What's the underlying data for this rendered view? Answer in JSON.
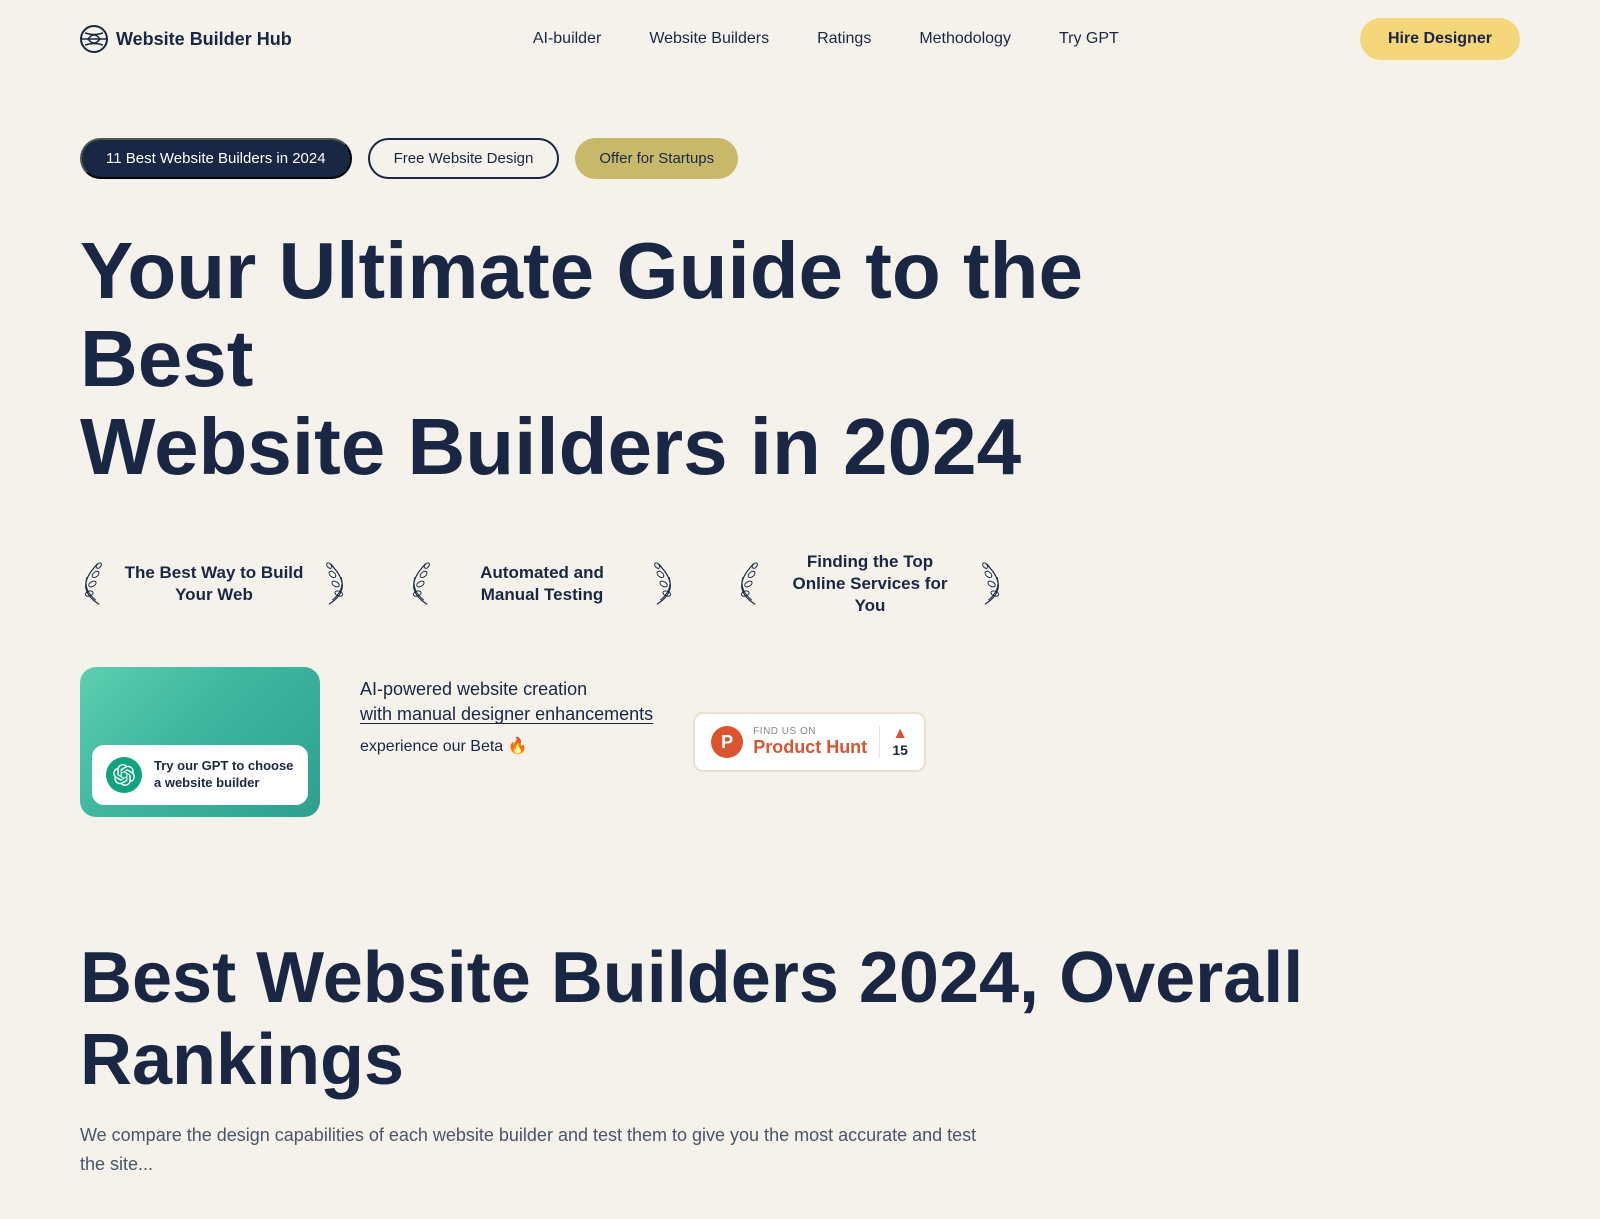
{
  "nav": {
    "logo_text": "Website Builder Hub",
    "links": [
      {
        "label": "AI-builder",
        "id": "ai-builder"
      },
      {
        "label": "Website Builders",
        "id": "website-builders"
      },
      {
        "label": "Ratings",
        "id": "ratings"
      },
      {
        "label": "Methodology",
        "id": "methodology"
      },
      {
        "label": "Try GPT",
        "id": "try-gpt"
      }
    ],
    "cta_label": "Hire Designer"
  },
  "hero": {
    "tags": [
      {
        "label": "11 Best Website Builders in 2024",
        "style": "dark"
      },
      {
        "label": "Free Website Design",
        "style": "light"
      },
      {
        "label": "Offer for Startups",
        "style": "olive"
      }
    ],
    "heading_line1": "Your Ultimate Guide to the Best",
    "heading_line2": "Website Builders in 2024"
  },
  "badges": [
    {
      "text": "The Best Way to Build Your Web"
    },
    {
      "text": "Automated and Manual Testing"
    },
    {
      "text": "Finding the Top Online Services for You"
    }
  ],
  "gpt_card": {
    "text": "Try our GPT to choose a website builder"
  },
  "ai_text": {
    "line1": "AI-powered website creation",
    "line2": "with manual designer enhancements",
    "beta": "experience our Beta 🔥"
  },
  "product_hunt": {
    "find_us_label": "FIND US ON",
    "name": "Product Hunt",
    "count": "15"
  },
  "bottom": {
    "heading": "Best Website Builders 2024, Overall Rankings",
    "subtext": "We compare the design capabilities of each website builder and test them to give you the most accurate and test the site..."
  }
}
